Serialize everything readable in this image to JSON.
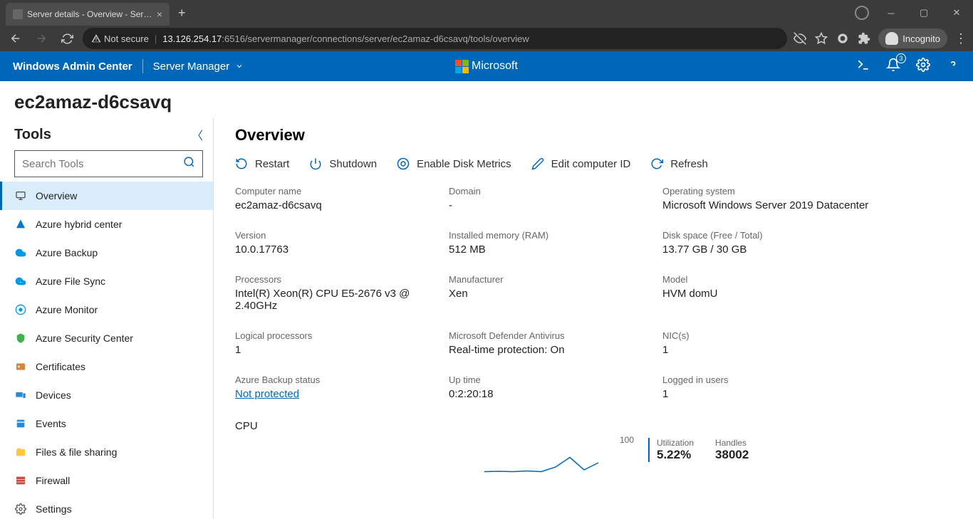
{
  "browser": {
    "tab_title": "Server details - Overview - Serve",
    "not_secure": "Not secure",
    "url_host": "13.126.254.17",
    "url_path": ":6516/servermanager/connections/server/ec2amaz-d6csavq/tools/overview",
    "incognito": "Incognito"
  },
  "header": {
    "brand": "Windows Admin Center",
    "context": "Server Manager",
    "ms": "Microsoft",
    "notif_count": "3"
  },
  "page": {
    "server_name": "ec2amaz-d6csavq"
  },
  "sidebar": {
    "title": "Tools",
    "search_placeholder": "Search Tools",
    "items": [
      {
        "icon": "overview",
        "label": "Overview",
        "active": true,
        "color": "#555"
      },
      {
        "icon": "azure-hybrid",
        "label": "Azure hybrid center",
        "color": "#0078d4"
      },
      {
        "icon": "azure-backup",
        "label": "Azure Backup",
        "color": "#0099e6"
      },
      {
        "icon": "azure-filesync",
        "label": "Azure File Sync",
        "color": "#0099e6"
      },
      {
        "icon": "azure-monitor",
        "label": "Azure Monitor",
        "color": "#0099e6"
      },
      {
        "icon": "azure-security",
        "label": "Azure Security Center",
        "color": "#3bb44a"
      },
      {
        "icon": "certificates",
        "label": "Certificates",
        "color": "#d8843a"
      },
      {
        "icon": "devices",
        "label": "Devices",
        "color": "#2a88d8"
      },
      {
        "icon": "events",
        "label": "Events",
        "color": "#2a88d8"
      },
      {
        "icon": "files",
        "label": "Files & file sharing",
        "color": "#ffc83d"
      },
      {
        "icon": "firewall",
        "label": "Firewall",
        "color": "#c84c3d"
      },
      {
        "icon": "settings",
        "label": "Settings",
        "color": "#555"
      }
    ]
  },
  "main": {
    "title": "Overview",
    "actions": {
      "restart": "Restart",
      "shutdown": "Shutdown",
      "disk_metrics": "Enable Disk Metrics",
      "edit_id": "Edit computer ID",
      "refresh": "Refresh"
    },
    "info": [
      {
        "label": "Computer name",
        "value": "ec2amaz-d6csavq"
      },
      {
        "label": "Domain",
        "value": "-"
      },
      {
        "label": "Operating system",
        "value": "Microsoft Windows Server 2019 Datacenter"
      },
      {
        "label": "Version",
        "value": "10.0.17763"
      },
      {
        "label": "Installed memory (RAM)",
        "value": "512 MB"
      },
      {
        "label": "Disk space (Free / Total)",
        "value": "13.77 GB / 30 GB"
      },
      {
        "label": "Processors",
        "value": "Intel(R) Xeon(R) CPU E5-2676 v3 @ 2.40GHz"
      },
      {
        "label": "Manufacturer",
        "value": "Xen"
      },
      {
        "label": "Model",
        "value": "HVM domU"
      },
      {
        "label": "Logical processors",
        "value": "1"
      },
      {
        "label": "Microsoft Defender Antivirus",
        "value": "Real-time protection: On"
      },
      {
        "label": "NIC(s)",
        "value": "1"
      },
      {
        "label": "Azure Backup status",
        "value": "Not protected",
        "link": true
      },
      {
        "label": "Up time",
        "value": "0:2:20:18"
      },
      {
        "label": "Logged in users",
        "value": "1"
      }
    ],
    "cpu": {
      "title": "CPU",
      "ymax": "100",
      "util_label": "Utilization",
      "util_value": "5.22%",
      "handles_label": "Handles",
      "handles_value": "38002"
    }
  },
  "chart_data": {
    "type": "line",
    "title": "CPU",
    "ylabel": "Utilization %",
    "ylim": [
      0,
      100
    ],
    "x": [
      0,
      1,
      2,
      3,
      4,
      5,
      6,
      7,
      8
    ],
    "values": [
      5,
      6,
      5,
      7,
      5,
      18,
      45,
      10,
      30
    ],
    "series": [
      {
        "name": "CPU Utilization",
        "values": [
          5,
          6,
          5,
          7,
          5,
          18,
          45,
          10,
          30
        ]
      }
    ]
  }
}
